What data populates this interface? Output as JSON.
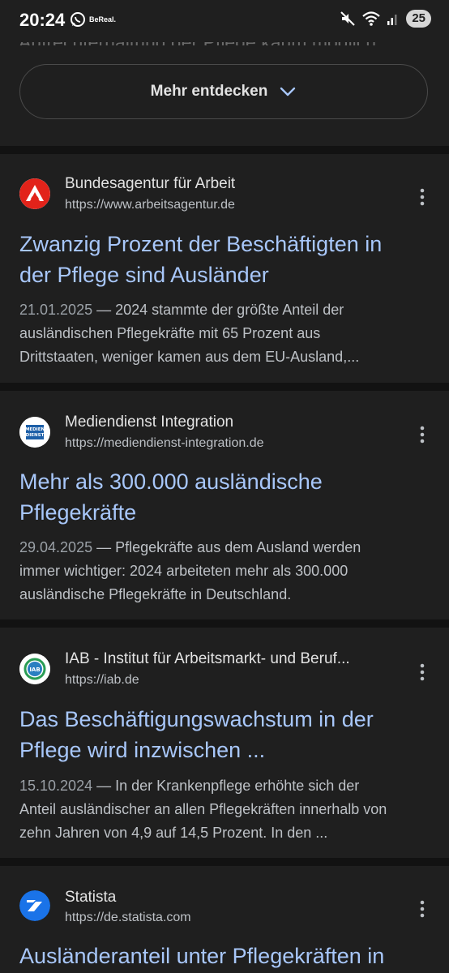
{
  "status_bar": {
    "time": "20:24",
    "notification_bereal": "BeReal.",
    "battery": "25"
  },
  "faded_text": "Aufrechterhaltung der Pflege kaum möglich",
  "more_button": {
    "label": "Mehr entdecken"
  },
  "results": [
    {
      "site_name": "Bundesagentur für Arbeit",
      "url": "https://www.arbeitsagentur.de",
      "title_lines": [
        "Zwanzig Prozent der Beschäftigten in",
        "der Pflege sind Ausländer"
      ],
      "date": "21.01.2025",
      "snippet_lines": [
        "— 2024 stammte der größte Anteil der",
        "ausländischen Pflegekräfte mit 65 Prozent aus",
        "Drittstaaten, weniger kamen aus dem EU-Ausland,..."
      ],
      "favicon_color": "#e2231a"
    },
    {
      "site_name": "Mediendienst Integration",
      "url": "https://mediendienst-integration.de",
      "title_lines": [
        "Mehr als 300.000 ausländische",
        "Pflegekräfte"
      ],
      "date": "29.04.2025",
      "snippet_lines": [
        "— Pflegekräfte aus dem Ausland werden",
        "immer wichtiger: 2024 arbeiteten mehr als 300.000",
        "ausländische Pflegekräfte in Deutschland."
      ],
      "favicon_color": "#1d5fa8",
      "favicon_text_1": "MEDIEN",
      "favicon_text_2": "DIENST"
    },
    {
      "site_name": "IAB - Institut für Arbeitsmarkt- und Beruf...",
      "url": "https://iab.de",
      "title_lines": [
        "Das Beschäftigungswachstum in der",
        "Pflege wird inzwischen ..."
      ],
      "date": "15.10.2024",
      "snippet_lines": [
        "— In der Krankenpflege erhöhte sich der",
        "Anteil ausländischer an allen Pflegekräften innerhalb von",
        "zehn Jahren von 4,9 auf 14,5 Prozent. In den ..."
      ],
      "favicon_color": "#2a7fc1",
      "favicon_text": "IAB"
    },
    {
      "site_name": "Statista",
      "url": "https://de.statista.com",
      "title_lines": [
        "Ausländeranteil unter Pflegekräften in"
      ],
      "favicon_color": "#1a73e8"
    }
  ]
}
